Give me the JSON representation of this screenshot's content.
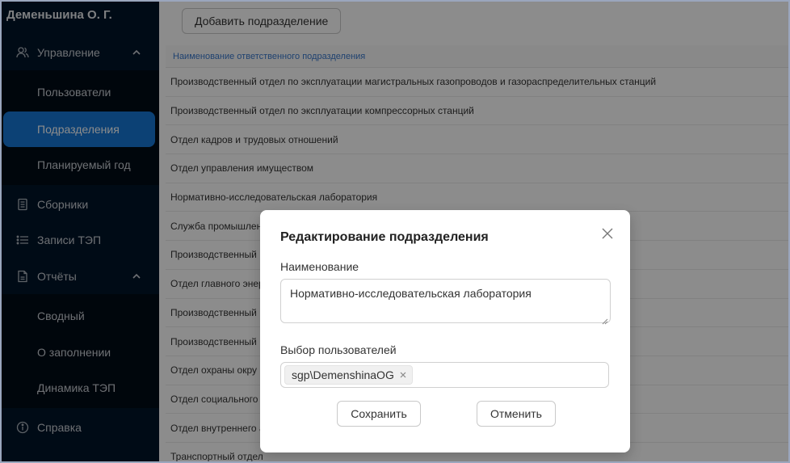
{
  "sidebar": {
    "user_name": "Деменьшина О. Г.",
    "menu": [
      {
        "label": "Управление",
        "icon": "user-group-icon",
        "expanded": true
      },
      {
        "label": "Сборники",
        "icon": "book-icon"
      },
      {
        "label": "Записи ТЭП",
        "icon": "list-icon"
      },
      {
        "label": "Отчёты",
        "icon": "file-icon",
        "expanded": true
      },
      {
        "label": "Справка",
        "icon": "info-circle-icon"
      }
    ],
    "management_items": [
      "Пользователи",
      "Подразделения",
      "Планируемый год"
    ],
    "reports_items": [
      "Сводный",
      "О заполнении",
      "Динамика ТЭП"
    ],
    "active_item": "Подразделения",
    "active_color": "#1677d6"
  },
  "content": {
    "add_button": "Добавить подразделение",
    "table_header": "Наименование ответственного подразделения",
    "rows": [
      "Производственный отдел по эксплуатации магистральных газопроводов и газораспределительных станций",
      "Производственный отдел по эксплуатации компрессорных станций",
      "Отдел кадров и трудовых отношений",
      "Отдел управления имуществом",
      "Нормативно-исследовательская лаборатория",
      "Служба промышлен",
      "Производственный",
      "Отдел главного энер",
      "Производственный",
      "Производственный",
      "Отдел охраны окру",
      "Отдел социального",
      "Отдел внутреннего а",
      "Транспортный отдел"
    ]
  },
  "modal": {
    "title": "Редактирование подразделения",
    "name_label": "Наименование",
    "name_value": "Нормативно-исследовательская лаборатория",
    "users_label": "Выбор пользователей",
    "selected_user": "sgp\\DemenshinaOG",
    "save_button": "Сохранить",
    "cancel_button": "Отменить"
  }
}
